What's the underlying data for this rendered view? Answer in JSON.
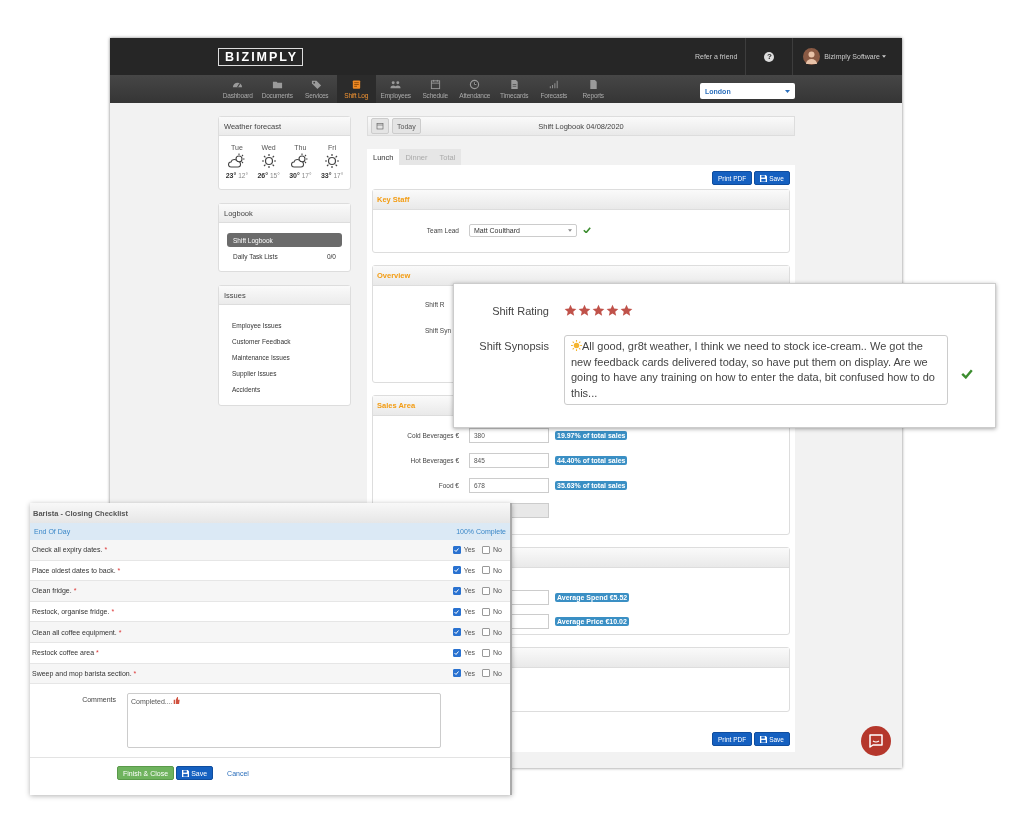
{
  "header": {
    "logo": "BIZIMPLY",
    "refer_link": "Refer a friend",
    "help": "?",
    "user_name": "Bizimply Software"
  },
  "nav": [
    {
      "label": "Dashboard",
      "selected": false
    },
    {
      "label": "Documents",
      "selected": false
    },
    {
      "label": "Services",
      "selected": false
    },
    {
      "label": "Shift Log",
      "selected": true
    },
    {
      "label": "Employees",
      "selected": false
    },
    {
      "label": "Schedule",
      "selected": false
    },
    {
      "label": "Attendance",
      "selected": false
    },
    {
      "label": "Timecards",
      "selected": false
    },
    {
      "label": "Forecasts",
      "selected": false
    },
    {
      "label": "Reports",
      "selected": false
    }
  ],
  "location": "London",
  "weather": {
    "title": "Weather forecast",
    "days": [
      {
        "day": "Tue",
        "kind": "cloudy",
        "high": "23°",
        "low": "12°"
      },
      {
        "day": "Wed",
        "kind": "sunny",
        "high": "26°",
        "low": "15°"
      },
      {
        "day": "Thu",
        "kind": "cloudy",
        "high": "30°",
        "low": "17°"
      },
      {
        "day": "Fri",
        "kind": "sunny",
        "high": "33°",
        "low": "17°"
      }
    ]
  },
  "logbook": {
    "title": "Logbook",
    "items": [
      {
        "label": "Shift Logbook",
        "selected": true
      },
      {
        "label": "Daily Task Lists",
        "count": "0/0",
        "selected": false
      }
    ]
  },
  "issues": {
    "title": "Issues",
    "items": [
      "Employee Issues",
      "Customer Feedback",
      "Maintenance Issues",
      "Supplier Issues",
      "Accidents"
    ]
  },
  "toolbar": {
    "today": "Today",
    "title": "Shift Logbook 04/08/2020"
  },
  "tabs": [
    {
      "label": "Lunch",
      "selected": true
    },
    {
      "label": "Dinner",
      "selected": false
    },
    {
      "label": "Total",
      "selected": false
    }
  ],
  "top_actions": [
    "Print PDF",
    "Save"
  ],
  "key_staff": {
    "title": "Key Staff",
    "label": "Team Lead",
    "value": "Matt Coulthard",
    "valid": true
  },
  "overview": {
    "title": "Overview",
    "labels": [
      "Shift R",
      "Shift Syn"
    ]
  },
  "sales_area": {
    "title": "Sales Area",
    "rows": [
      {
        "label": "Cold Beverages €",
        "value": "380",
        "note": "19.97% of total sales",
        "disabled": false
      },
      {
        "label": "Hot Beverages €",
        "value": "845",
        "note": "44.40% of total sales",
        "disabled": false
      },
      {
        "label": "Food €",
        "value": "678",
        "note": "35.63% of total sales",
        "disabled": false
      },
      {
        "disabled": true
      }
    ]
  },
  "averages": {
    "notes": [
      "Average Spend €5.52",
      "Average Price €10.02"
    ]
  },
  "bottom_actions": [
    "Print PDF",
    "Save"
  ],
  "rating": {
    "rating_label": "Shift Rating",
    "stars": 5,
    "synopsis_label": "Shift Synopsis",
    "synopsis": "All good, gr8t weather, I think we need to stock ice-cream.. We got the new feedback cards delivered today, so have put them on display. Are we going to have any training on how to enter the data, bit confused how to do this...",
    "valid": true
  },
  "checklist": {
    "title": "Barista - Closing Checklist",
    "section": "End Of Day",
    "progress": "100% Complete",
    "items": [
      {
        "task": "Check all expiry dates.",
        "mark": "*",
        "yes": {
          "label": "Yes",
          "checked": true
        },
        "no": {
          "label": "No",
          "checked": false
        }
      },
      {
        "task": "Place oldest dates to back.",
        "mark": "*",
        "yes": {
          "label": "Yes",
          "checked": true
        },
        "no": {
          "label": "No",
          "checked": false
        }
      },
      {
        "task": "Clean fridge.",
        "mark": "*",
        "yes": {
          "label": "Yes",
          "checked": true
        },
        "no": {
          "label": "No",
          "checked": false
        }
      },
      {
        "task": "Restock, organise fridge.",
        "mark": "*",
        "yes": {
          "label": "Yes",
          "checked": true
        },
        "no": {
          "label": "No",
          "checked": false
        }
      },
      {
        "task": "Clean all coffee equipment.",
        "mark": "*",
        "yes": {
          "label": "Yes",
          "checked": true
        },
        "no": {
          "label": "No",
          "checked": false
        }
      },
      {
        "task": "Restock coffee area",
        "mark": "*",
        "yes": {
          "label": "Yes",
          "checked": true
        },
        "no": {
          "label": "No",
          "checked": false
        }
      },
      {
        "task": "Sweep and mop barista section.",
        "mark": "*",
        "yes": {
          "label": "Yes",
          "checked": true
        },
        "no": {
          "label": "No",
          "checked": false
        }
      }
    ],
    "comments_label": "Comments",
    "comments": "Completed....",
    "buttons": [
      "Finish & Close",
      "Save",
      "Cancel"
    ]
  }
}
